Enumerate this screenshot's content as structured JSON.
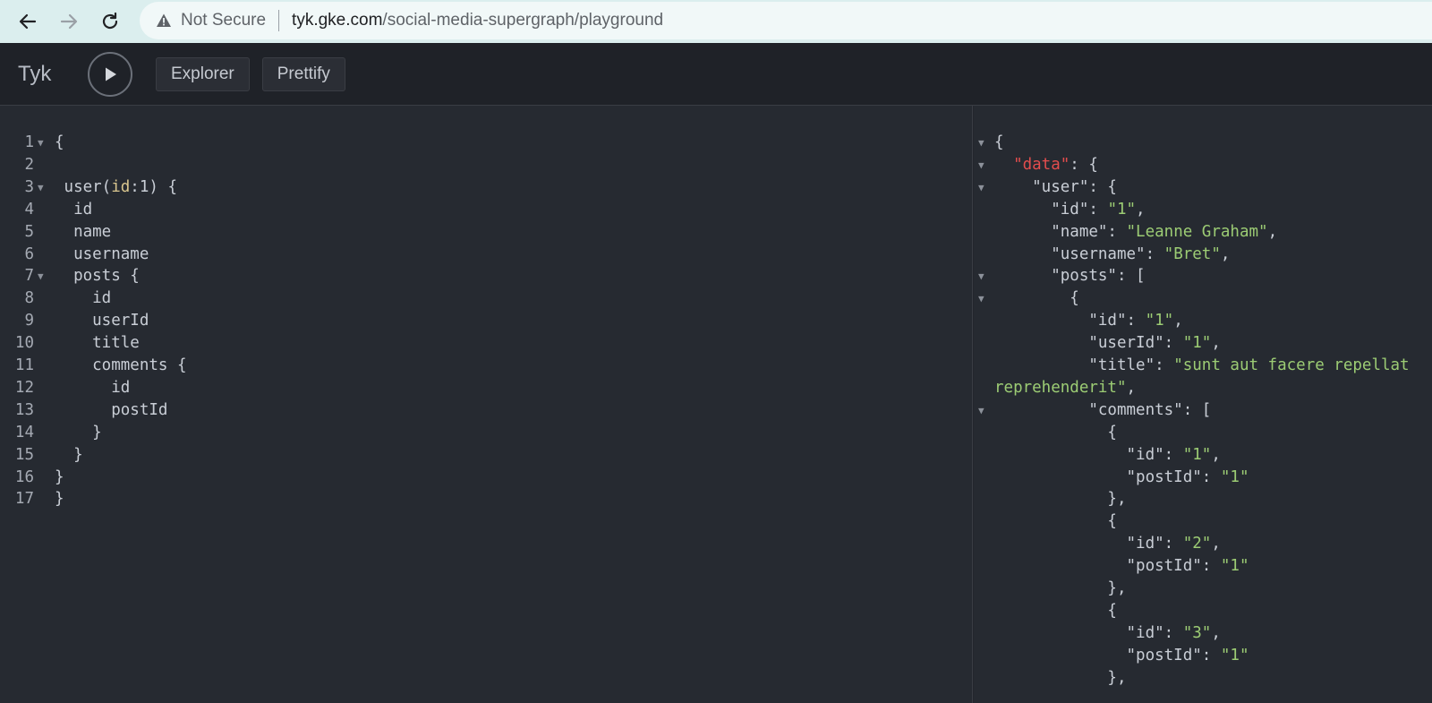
{
  "browser": {
    "back_icon": "arrow-left-icon",
    "forward_icon": "arrow-right-icon",
    "reload_icon": "reload-icon",
    "security_label": "Not Secure",
    "url_host": "tyk.gke.com",
    "url_path": "/social-media-supergraph/playground"
  },
  "toolbar": {
    "brand": "Tyk",
    "explorer_label": "Explorer",
    "prettify_label": "Prettify"
  },
  "editor": {
    "lines": [
      {
        "num": "1",
        "fold": true,
        "parts": [
          {
            "t": "{",
            "c": ""
          }
        ]
      },
      {
        "num": "2",
        "fold": false,
        "parts": []
      },
      {
        "num": "3",
        "fold": true,
        "parts": [
          {
            "t": " user(",
            "c": ""
          },
          {
            "t": "id",
            "c": "arg"
          },
          {
            "t": ":1) {",
            "c": ""
          }
        ]
      },
      {
        "num": "4",
        "fold": false,
        "parts": [
          {
            "t": "  id",
            "c": ""
          }
        ]
      },
      {
        "num": "5",
        "fold": false,
        "parts": [
          {
            "t": "  name",
            "c": ""
          }
        ]
      },
      {
        "num": "6",
        "fold": false,
        "parts": [
          {
            "t": "  username",
            "c": ""
          }
        ]
      },
      {
        "num": "7",
        "fold": true,
        "parts": [
          {
            "t": "  posts {",
            "c": ""
          }
        ]
      },
      {
        "num": "8",
        "fold": false,
        "parts": [
          {
            "t": "    id",
            "c": ""
          }
        ]
      },
      {
        "num": "9",
        "fold": false,
        "parts": [
          {
            "t": "    userId",
            "c": ""
          }
        ]
      },
      {
        "num": "10",
        "fold": false,
        "parts": [
          {
            "t": "    title",
            "c": ""
          }
        ]
      },
      {
        "num": "11",
        "fold": false,
        "parts": [
          {
            "t": "    comments {",
            "c": ""
          }
        ]
      },
      {
        "num": "12",
        "fold": false,
        "parts": [
          {
            "t": "      id",
            "c": ""
          }
        ]
      },
      {
        "num": "13",
        "fold": false,
        "parts": [
          {
            "t": "      postId",
            "c": ""
          }
        ]
      },
      {
        "num": "14",
        "fold": false,
        "parts": [
          {
            "t": "    }",
            "c": ""
          }
        ]
      },
      {
        "num": "15",
        "fold": false,
        "parts": [
          {
            "t": "  }",
            "c": ""
          }
        ]
      },
      {
        "num": "16",
        "fold": false,
        "parts": [
          {
            "t": "}",
            "c": ""
          }
        ]
      },
      {
        "num": "17",
        "fold": false,
        "parts": [
          {
            "t": "}",
            "c": ""
          }
        ]
      }
    ]
  },
  "result": {
    "lines": [
      {
        "fold": true,
        "parts": [
          {
            "t": "{",
            "c": ""
          }
        ]
      },
      {
        "fold": true,
        "parts": [
          {
            "t": "  ",
            "c": ""
          },
          {
            "t": "\"data\"",
            "c": "key-data"
          },
          {
            "t": ": {",
            "c": ""
          }
        ]
      },
      {
        "fold": true,
        "parts": [
          {
            "t": "    \"user\": {",
            "c": ""
          }
        ]
      },
      {
        "fold": false,
        "parts": [
          {
            "t": "      \"id\": ",
            "c": ""
          },
          {
            "t": "\"1\"",
            "c": "str"
          },
          {
            "t": ",",
            "c": ""
          }
        ]
      },
      {
        "fold": false,
        "parts": [
          {
            "t": "      \"name\": ",
            "c": ""
          },
          {
            "t": "\"Leanne Graham\"",
            "c": "str"
          },
          {
            "t": ",",
            "c": ""
          }
        ]
      },
      {
        "fold": false,
        "parts": [
          {
            "t": "      \"username\": ",
            "c": ""
          },
          {
            "t": "\"Bret\"",
            "c": "str"
          },
          {
            "t": ",",
            "c": ""
          }
        ]
      },
      {
        "fold": true,
        "parts": [
          {
            "t": "      \"posts\": [",
            "c": ""
          }
        ]
      },
      {
        "fold": true,
        "parts": [
          {
            "t": "        {",
            "c": ""
          }
        ]
      },
      {
        "fold": false,
        "parts": [
          {
            "t": "          \"id\": ",
            "c": ""
          },
          {
            "t": "\"1\"",
            "c": "str"
          },
          {
            "t": ",",
            "c": ""
          }
        ]
      },
      {
        "fold": false,
        "parts": [
          {
            "t": "          \"userId\": ",
            "c": ""
          },
          {
            "t": "\"1\"",
            "c": "str"
          },
          {
            "t": ",",
            "c": ""
          }
        ]
      },
      {
        "fold": false,
        "parts": [
          {
            "t": "          \"title\": ",
            "c": ""
          },
          {
            "t": "\"sunt aut facere repellat",
            "c": "str"
          }
        ]
      },
      {
        "fold": false,
        "parts": [
          {
            "t": "reprehenderit\"",
            "c": "str"
          },
          {
            "t": ",",
            "c": ""
          }
        ]
      },
      {
        "fold": true,
        "parts": [
          {
            "t": "          \"comments\": [",
            "c": ""
          }
        ]
      },
      {
        "fold": false,
        "parts": [
          {
            "t": "            {",
            "c": ""
          }
        ]
      },
      {
        "fold": false,
        "parts": [
          {
            "t": "              \"id\": ",
            "c": ""
          },
          {
            "t": "\"1\"",
            "c": "str"
          },
          {
            "t": ",",
            "c": ""
          }
        ]
      },
      {
        "fold": false,
        "parts": [
          {
            "t": "              \"postId\": ",
            "c": ""
          },
          {
            "t": "\"1\"",
            "c": "str"
          }
        ]
      },
      {
        "fold": false,
        "parts": [
          {
            "t": "            },",
            "c": ""
          }
        ]
      },
      {
        "fold": false,
        "parts": [
          {
            "t": "            {",
            "c": ""
          }
        ]
      },
      {
        "fold": false,
        "parts": [
          {
            "t": "              \"id\": ",
            "c": ""
          },
          {
            "t": "\"2\"",
            "c": "str"
          },
          {
            "t": ",",
            "c": ""
          }
        ]
      },
      {
        "fold": false,
        "parts": [
          {
            "t": "              \"postId\": ",
            "c": ""
          },
          {
            "t": "\"1\"",
            "c": "str"
          }
        ]
      },
      {
        "fold": false,
        "parts": [
          {
            "t": "            },",
            "c": ""
          }
        ]
      },
      {
        "fold": false,
        "parts": [
          {
            "t": "            {",
            "c": ""
          }
        ]
      },
      {
        "fold": false,
        "parts": [
          {
            "t": "              \"id\": ",
            "c": ""
          },
          {
            "t": "\"3\"",
            "c": "str"
          },
          {
            "t": ",",
            "c": ""
          }
        ]
      },
      {
        "fold": false,
        "parts": [
          {
            "t": "              \"postId\": ",
            "c": ""
          },
          {
            "t": "\"1\"",
            "c": "str"
          }
        ]
      },
      {
        "fold": false,
        "parts": [
          {
            "t": "            },",
            "c": ""
          }
        ]
      }
    ]
  }
}
